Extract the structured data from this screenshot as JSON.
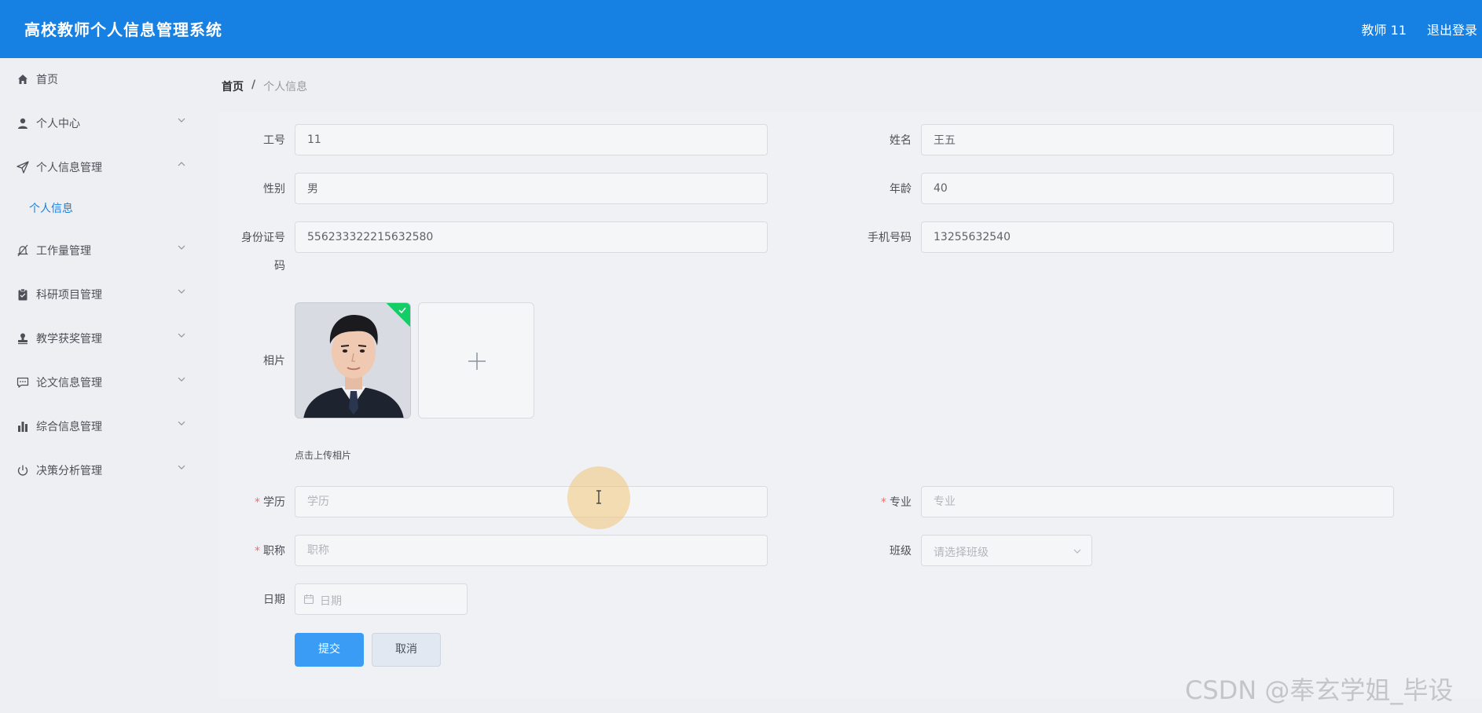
{
  "header": {
    "app_title": "高校教师个人信息管理系统",
    "user_label": "教师 11",
    "logout_label": "退出登录"
  },
  "sidebar": {
    "items": [
      {
        "label": "首页",
        "icon": "home-icon"
      },
      {
        "label": "个人中心",
        "icon": "user-icon"
      },
      {
        "label": "个人信息管理",
        "icon": "send-icon"
      },
      {
        "label": "工作量管理",
        "icon": "bell-off-icon"
      },
      {
        "label": "科研项目管理",
        "icon": "clipboard-icon"
      },
      {
        "label": "教学获奖管理",
        "icon": "stamp-icon"
      },
      {
        "label": "论文信息管理",
        "icon": "chat-icon"
      },
      {
        "label": "综合信息管理",
        "icon": "bar-chart-icon"
      },
      {
        "label": "决策分析管理",
        "icon": "power-icon"
      }
    ],
    "submenu": {
      "label": "个人信息"
    }
  },
  "breadcrumb": {
    "home": "首页",
    "separator": "/",
    "current": "个人信息"
  },
  "form": {
    "gonghao": {
      "label": "工号",
      "value": "11"
    },
    "xingming": {
      "label": "姓名",
      "value": "王五"
    },
    "xingbie": {
      "label": "性别",
      "value": "男"
    },
    "nianling": {
      "label": "年龄",
      "value": "40"
    },
    "shenfenzheng": {
      "label_line1": "身份证号",
      "label_line2": "码",
      "value": "556233322215632580"
    },
    "shouji": {
      "label": "手机号码",
      "value": "13255632540"
    },
    "photo": {
      "label": "相片",
      "tip": "点击上传相片"
    },
    "xueli": {
      "label": "学历",
      "placeholder": "学历",
      "required_mark": "*"
    },
    "zhuanye": {
      "label": "专业",
      "placeholder": "专业",
      "required_mark": "*"
    },
    "zhicheng": {
      "label": "职称",
      "placeholder": "职称",
      "required_mark": "*"
    },
    "banji": {
      "label": "班级",
      "placeholder": "请选择班级"
    },
    "riqi": {
      "label": "日期",
      "placeholder": "日期"
    },
    "submit_label": "提交",
    "cancel_label": "取消"
  },
  "watermark": "CSDN @奉玄学姐_毕设",
  "colors": {
    "primary": "#1681e2",
    "button_primary": "#3a9cf5",
    "success": "#13ce66",
    "required": "#f56c6c"
  }
}
